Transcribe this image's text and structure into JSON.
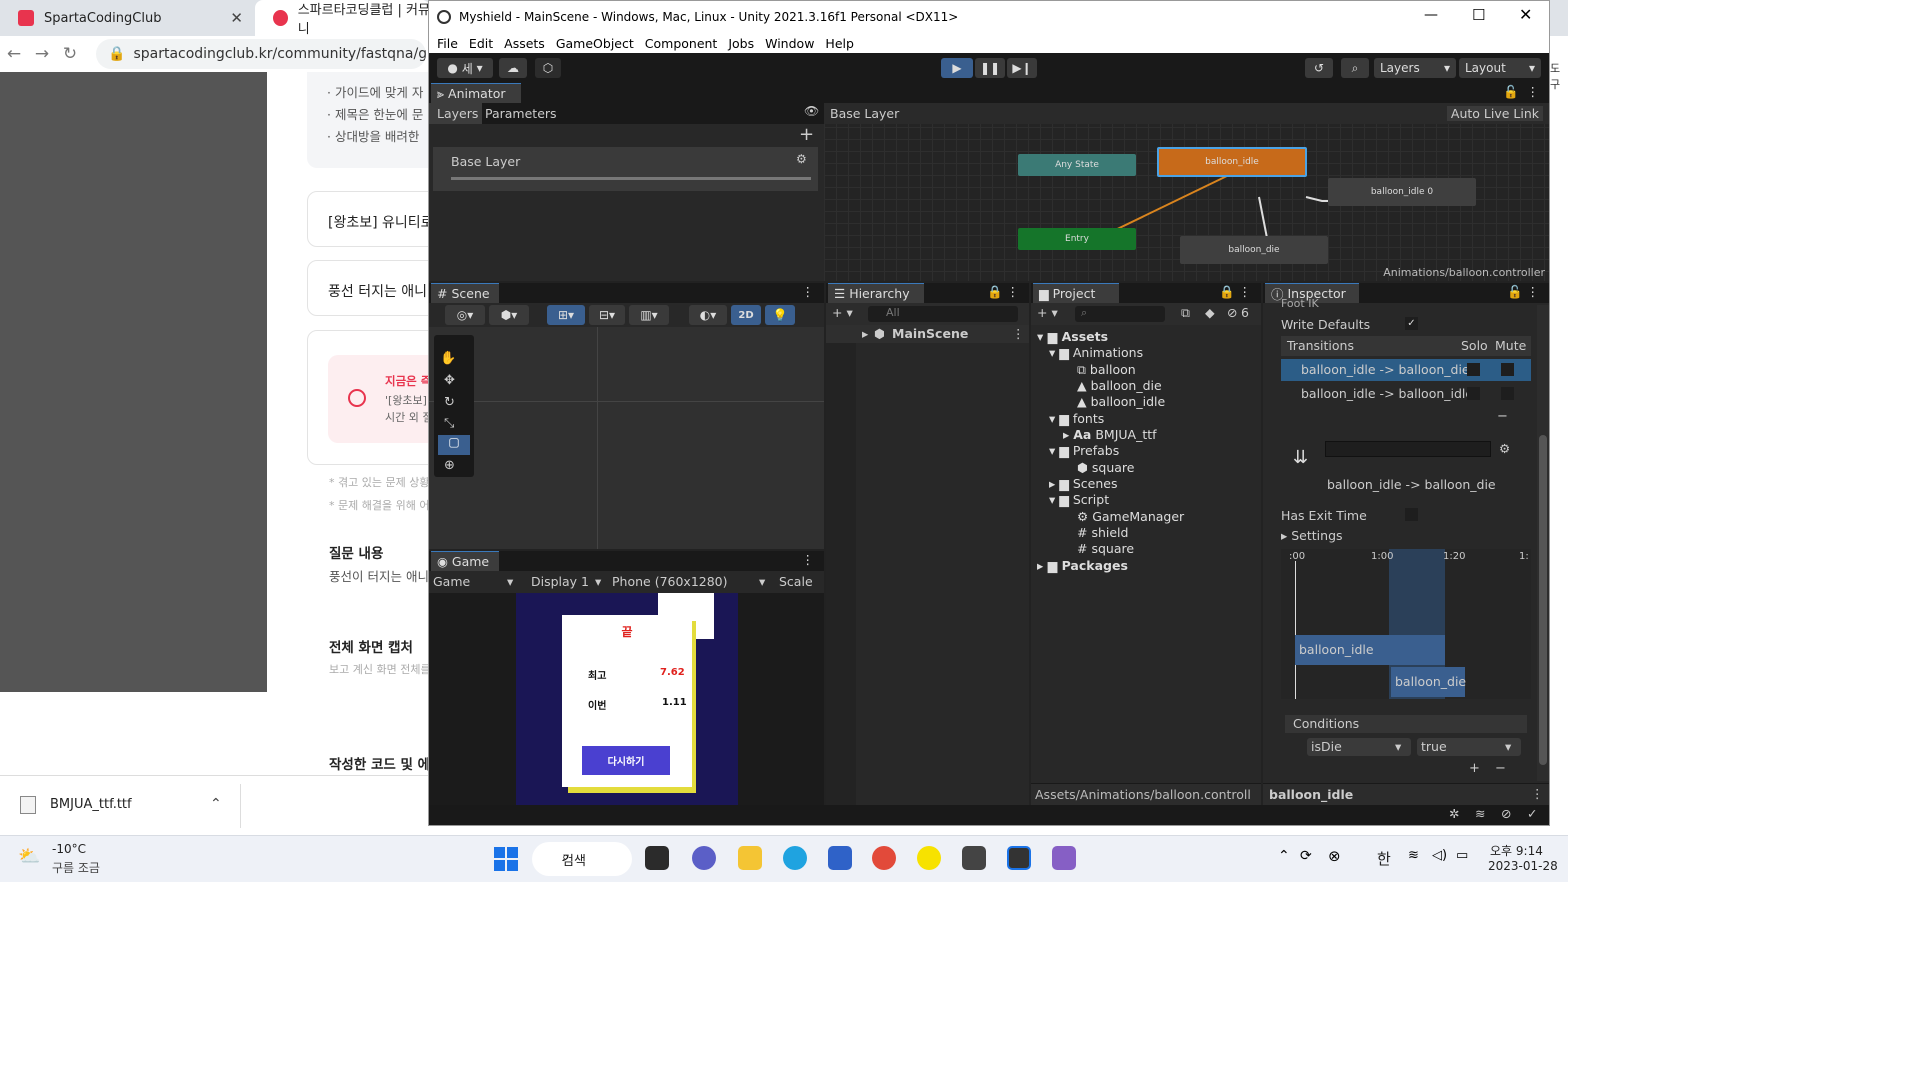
{
  "browser": {
    "tab1": "SpartaCodingClub",
    "tab2": "스파르타코딩클럽 | 커뮤니",
    "url": "spartacodingclub.kr/community/fastqna/go",
    "bullets": [
      "· 가이드에 맞게 자",
      "· 제목은 한눈에 문",
      "· 상대방을 배려한"
    ],
    "card1": "[왕초보] 유니티로",
    "card2": "풍선 터지는 애니",
    "alert_title": "지금은 즉",
    "alert_l1": "'[왕초보]",
    "alert_l2": "시간 외 질",
    "note1": "* 겪고 있는 문제 상황",
    "note2": "* 문제 해결을 위해 어",
    "q_title": "질문 내용",
    "q_text": "풍선이 터지는 애니",
    "cap_title": "전체 화면 캡처",
    "cap_text": "보고 계신 화면 전체를",
    "code_title": "작성한 코드 및 에러",
    "download": "BMJUA_ttf.ttf"
  },
  "unity": {
    "title": "Myshield - MainScene - Windows, Mac, Linux - Unity 2021.3.16f1 Personal <DX11>",
    "menu": [
      "File",
      "Edit",
      "Assets",
      "GameObject",
      "Component",
      "Jobs",
      "Window",
      "Help"
    ],
    "account": "세",
    "layers": "Layers",
    "layout": "Layout",
    "animator": {
      "tab": "Animator",
      "layers_tab": "Layers",
      "params_tab": "Parameters",
      "base_layer": "Base Layer",
      "breadcrumb": "Base Layer",
      "auto_live": "Auto Live Link",
      "path": "Animations/balloon.controller",
      "nodes": {
        "any": "Any State",
        "idle": "balloon_idle",
        "idle0": "balloon_idle 0",
        "entry": "Entry",
        "die": "balloon_die"
      }
    },
    "scene": {
      "tab": "Scene",
      "mode2d": "2D"
    },
    "game": {
      "tab": "Game",
      "game_dd": "Game",
      "display": "Display 1",
      "res": "Phone (760x1280)",
      "scale": "Scale",
      "title": "끝",
      "best_label": "최고",
      "best_value": "7.62",
      "cur_label": "이번",
      "cur_value": "1.11",
      "retry": "다시하기"
    },
    "hierarchy": {
      "tab": "Hierarchy",
      "search": "All",
      "scene": "MainScene"
    },
    "project": {
      "tab": "Project",
      "badge": "6",
      "path": "Assets/Animations/balloon.controll",
      "tree": [
        "Assets",
        "Animations",
        "balloon",
        "balloon_die",
        "balloon_idle",
        "fonts",
        "BMJUA_ttf",
        "Prefabs",
        "square",
        "Scenes",
        "Script",
        "GameManager",
        "shield",
        "square",
        "Packages"
      ]
    },
    "inspector": {
      "tab": "Inspector",
      "footik": "Foot IK",
      "write_defaults": "Write Defaults",
      "transitions": "Transitions",
      "solo": "Solo",
      "mute": "Mute",
      "trans1": "balloon_idle -> balloon_die",
      "trans2": "balloon_idle -> balloon_idle",
      "trans_name": "balloon_idle -> balloon_die",
      "has_exit": "Has Exit Time",
      "settings": "Settings",
      "t0": ":00",
      "t1": "1:00",
      "t2": "1:20",
      "t3": "1:",
      "clip_a": "balloon_idle",
      "clip_b": "balloon_die",
      "conditions": "Conditions",
      "cond_param": "isDie",
      "cond_val": "true",
      "footer": "balloon_idle"
    }
  },
  "taskbar": {
    "temp": "-10°C",
    "weather": "구름 조금",
    "search": "검색",
    "ime": "한",
    "time": "오후 9:14",
    "date": "2023-01-28"
  }
}
